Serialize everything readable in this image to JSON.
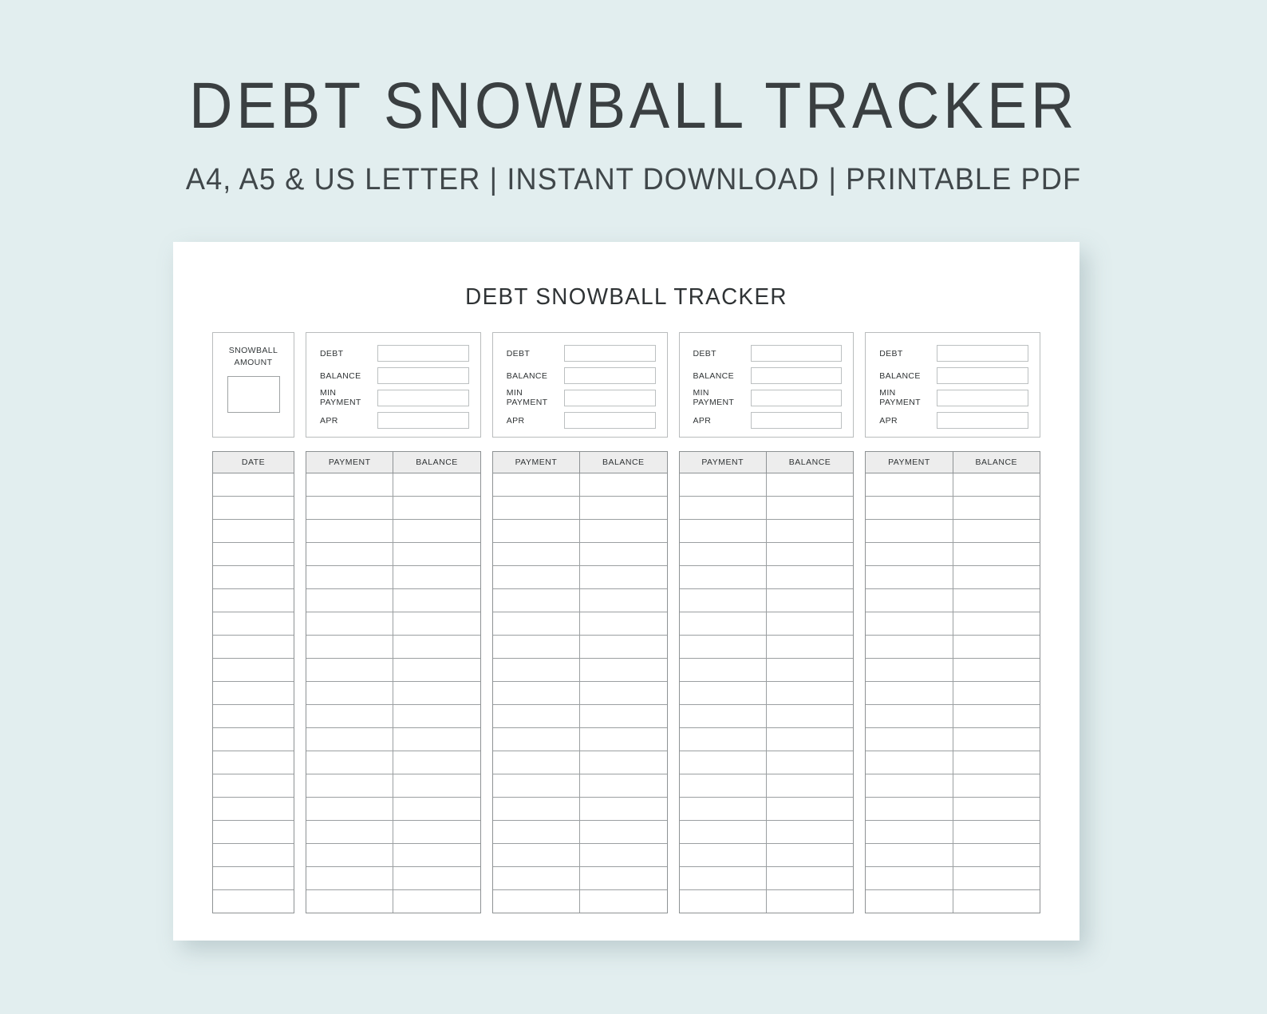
{
  "promo": {
    "title": "DEBT SNOWBALL TRACKER",
    "subtitle": "A4, A5 & US LETTER  |  INSTANT DOWNLOAD  |  PRINTABLE PDF"
  },
  "colors": {
    "background": "#e2eeef",
    "sheet": "#ffffff",
    "text": "#2f3335",
    "border": "#8e9294",
    "header_fill": "#ededed"
  },
  "sheet": {
    "title": "DEBT SNOWBALL TRACKER",
    "snowball": {
      "label_line1": "SNOWBALL",
      "label_line2": "AMOUNT",
      "value": ""
    },
    "debt_cards": [
      {
        "fields": [
          {
            "label": "DEBT",
            "value": ""
          },
          {
            "label": "BALANCE",
            "value": ""
          },
          {
            "label_line1": "MIN",
            "label_line2": "PAYMENT",
            "value": ""
          },
          {
            "label": "APR",
            "value": ""
          }
        ]
      },
      {
        "fields": [
          {
            "label": "DEBT",
            "value": ""
          },
          {
            "label": "BALANCE",
            "value": ""
          },
          {
            "label_line1": "MIN",
            "label_line2": "PAYMENT",
            "value": ""
          },
          {
            "label": "APR",
            "value": ""
          }
        ]
      },
      {
        "fields": [
          {
            "label": "DEBT",
            "value": ""
          },
          {
            "label": "BALANCE",
            "value": ""
          },
          {
            "label_line1": "MIN",
            "label_line2": "PAYMENT",
            "value": ""
          },
          {
            "label": "APR",
            "value": ""
          }
        ]
      },
      {
        "fields": [
          {
            "label": "DEBT",
            "value": ""
          },
          {
            "label": "BALANCE",
            "value": ""
          },
          {
            "label_line1": "MIN",
            "label_line2": "PAYMENT",
            "value": ""
          },
          {
            "label": "APR",
            "value": ""
          }
        ]
      }
    ],
    "table": {
      "row_count": 19,
      "groups": [
        {
          "headers": [
            "DATE"
          ]
        },
        {
          "headers": [
            "PAYMENT",
            "BALANCE"
          ]
        },
        {
          "headers": [
            "PAYMENT",
            "BALANCE"
          ]
        },
        {
          "headers": [
            "PAYMENT",
            "BALANCE"
          ]
        },
        {
          "headers": [
            "PAYMENT",
            "BALANCE"
          ]
        }
      ],
      "rows": []
    }
  }
}
